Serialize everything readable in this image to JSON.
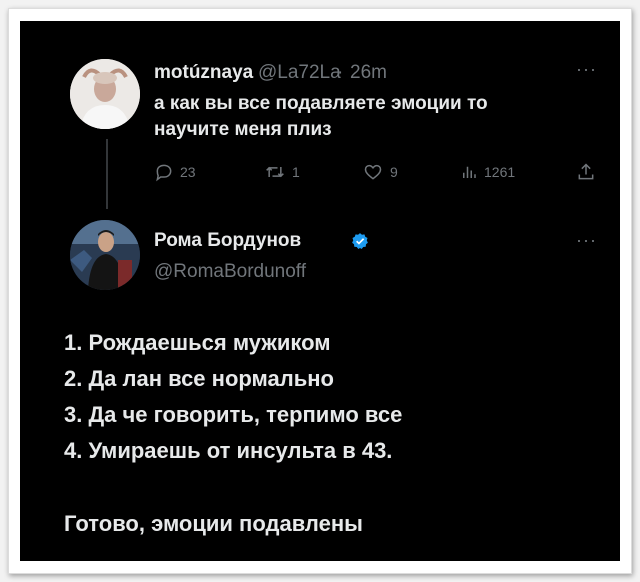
{
  "reply_to": {
    "display_name": "motúznaya",
    "handle": "@La72La",
    "sep": "·",
    "time": "26m",
    "text_lines": [
      "а как вы все подавляете эмоции то",
      "научите меня плиз"
    ],
    "actions": {
      "replies": "23",
      "retweets": "1",
      "likes": "9",
      "views": "1261"
    },
    "more": "···"
  },
  "main_tweet": {
    "display_name": "Рома Бордунов",
    "handle": "@RomaBordunoff",
    "verified": true,
    "more": "···",
    "lines": [
      "1. Рождаешься мужиком",
      "2. Да лан все нормально",
      "3. Да че говорить, терпимо все",
      "4. Умираешь от инсульта в 43.",
      "Готово, эмоции подавлены"
    ]
  },
  "colors": {
    "background": "#000000",
    "text": "#e7e9ea",
    "secondary": "#71767b",
    "verified": "#1d9bf0"
  }
}
